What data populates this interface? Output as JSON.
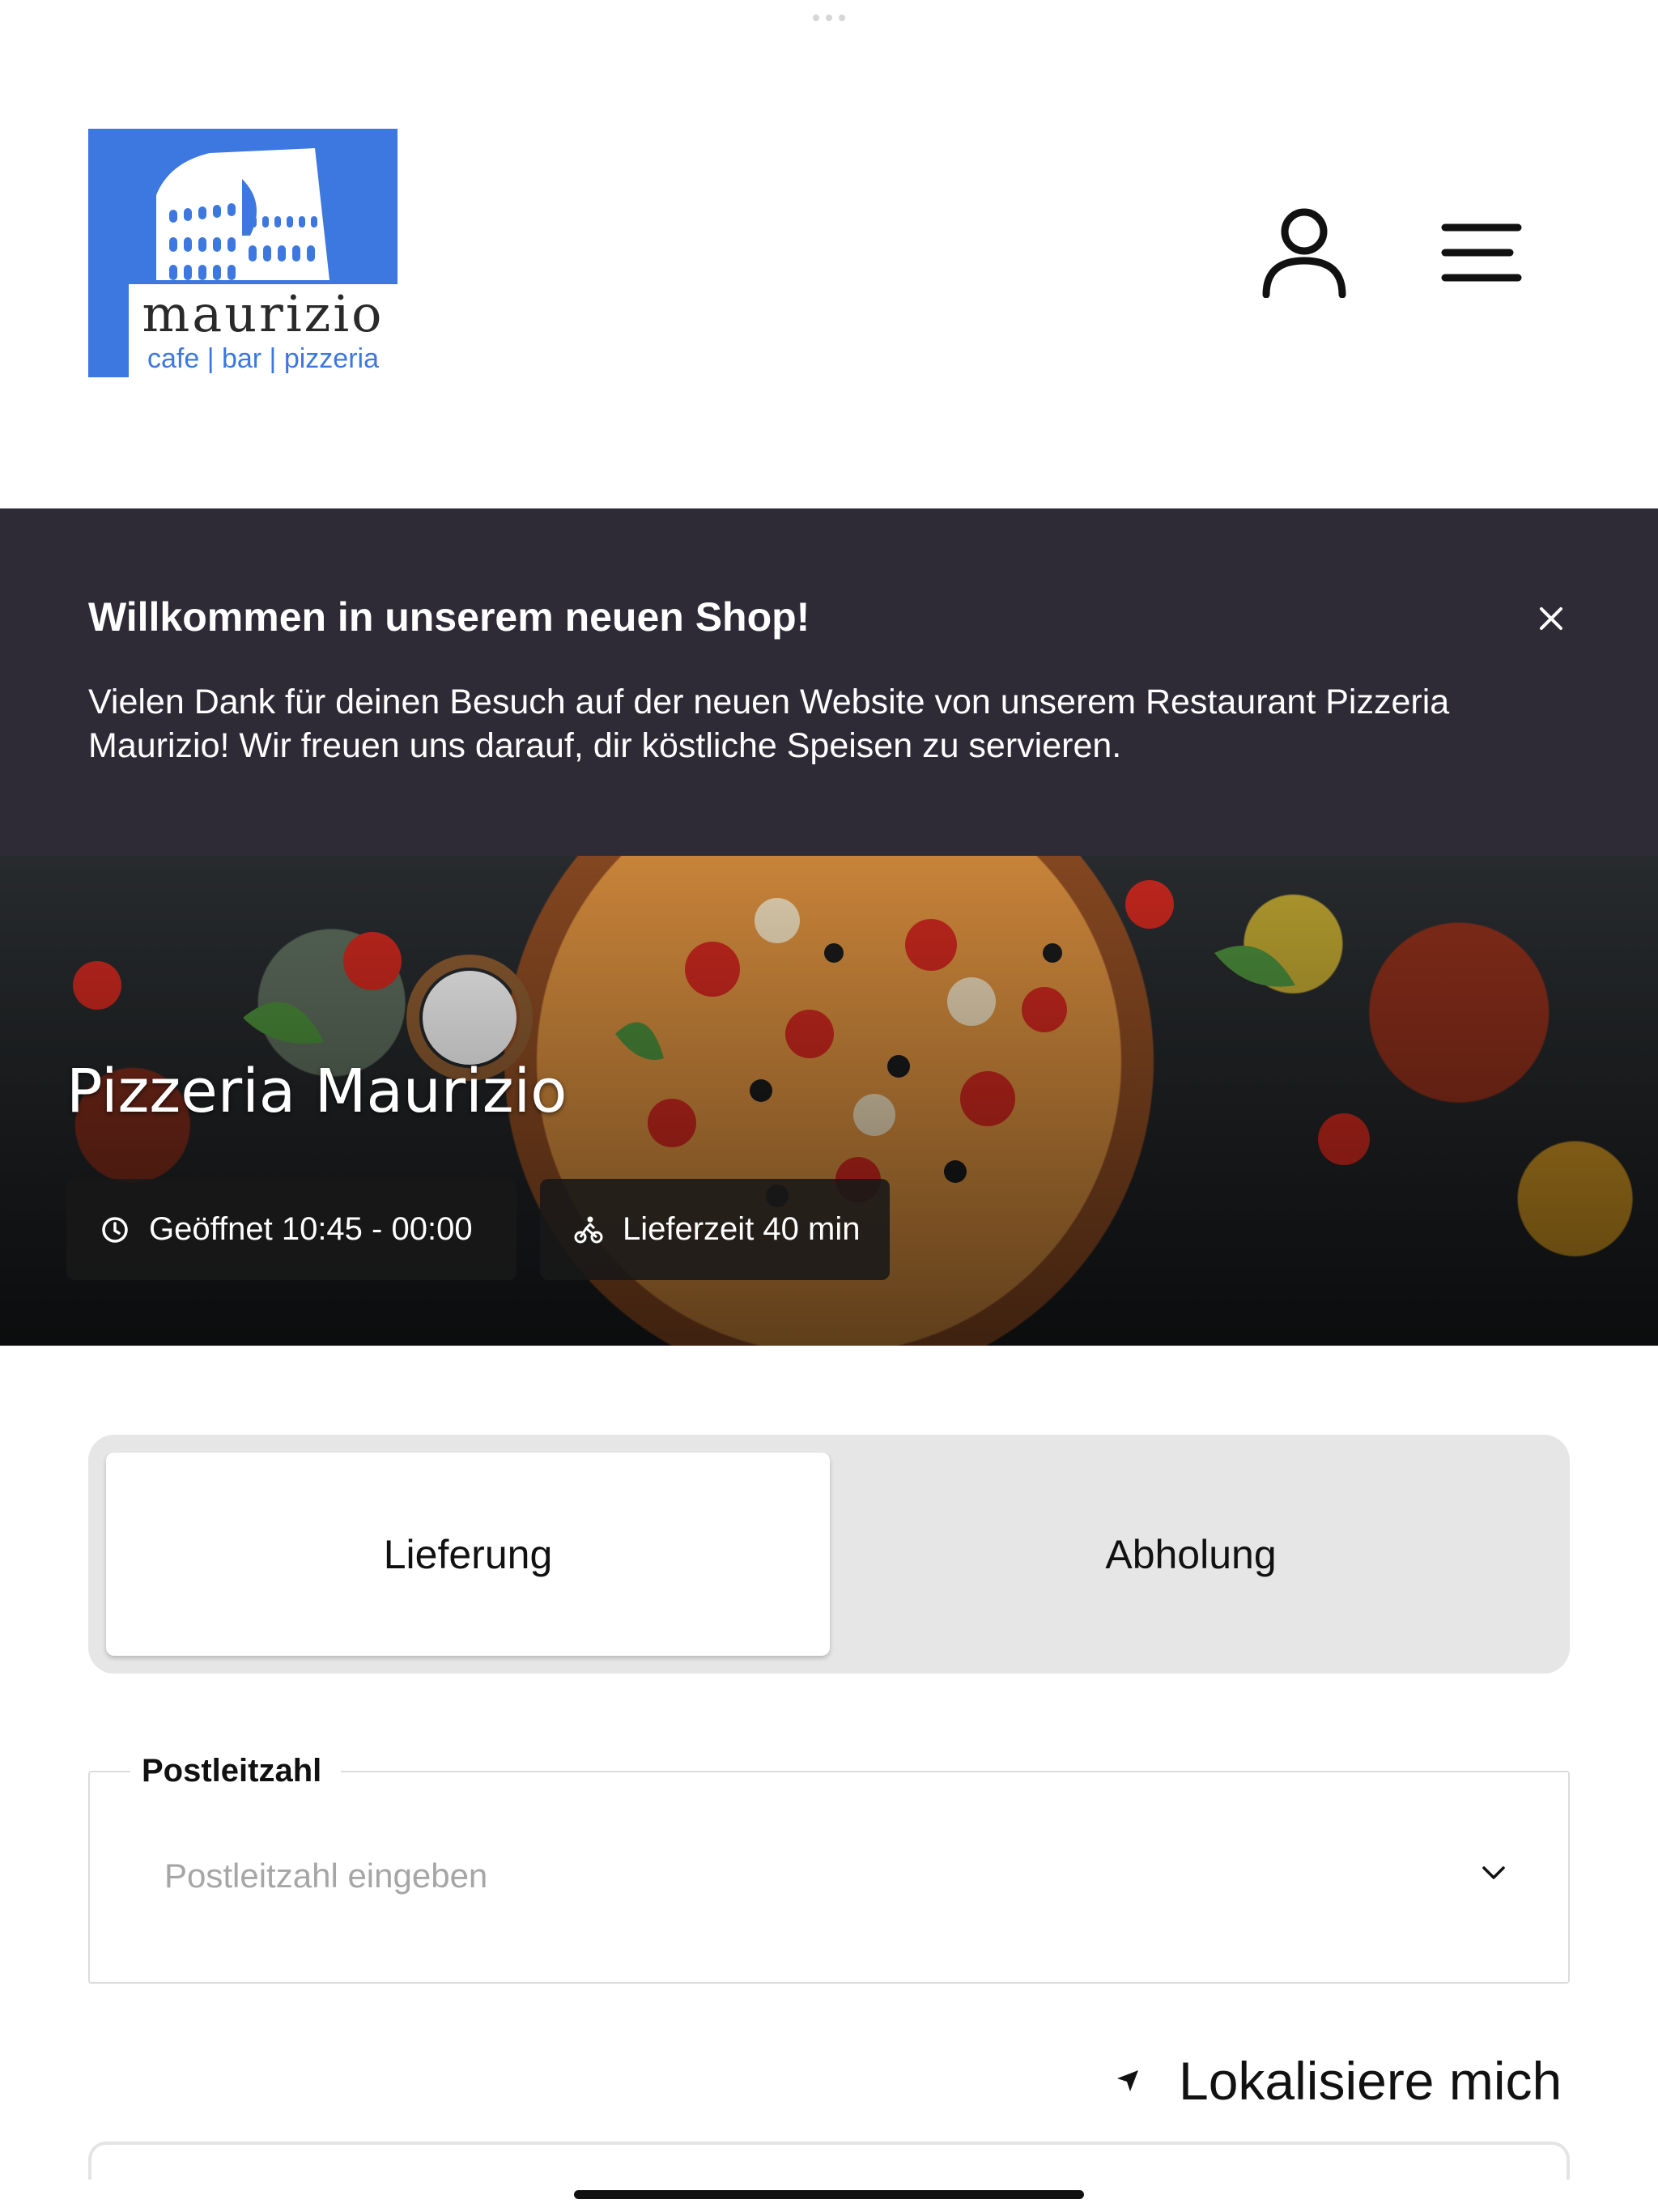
{
  "header": {
    "logo_name": "maurizio",
    "logo_subtitle": "cafe | bar | pizzeria",
    "account_icon": "user-icon",
    "menu_icon": "hamburger-menu-icon"
  },
  "banner": {
    "title": "Willkommen in unserem neuen Shop!",
    "text": "Vielen Dank für deinen Besuch auf der neuen Website von unserem Restaurant Pizzeria Maurizio! Wir freuen uns darauf, dir köstliche Speisen zu servieren.",
    "close_icon": "close-icon",
    "background_color": "#2e2b36"
  },
  "hero": {
    "title": "Pizzeria Maurizio",
    "opening_hours": "Geöffnet 10:45 - 00:00",
    "delivery_time": "Lieferzeit 40 min"
  },
  "order_mode": {
    "options": [
      "Lieferung",
      "Abholung"
    ],
    "selected": "Lieferung"
  },
  "postal_field": {
    "label": "Postleitzahl",
    "placeholder": "Postleitzahl eingeben",
    "value": ""
  },
  "locate": {
    "label": "Lokalisiere mich",
    "icon": "location-arrow-icon"
  },
  "colors": {
    "logo_blue": "#3d78e0",
    "segment_background": "#e6e6e6"
  }
}
